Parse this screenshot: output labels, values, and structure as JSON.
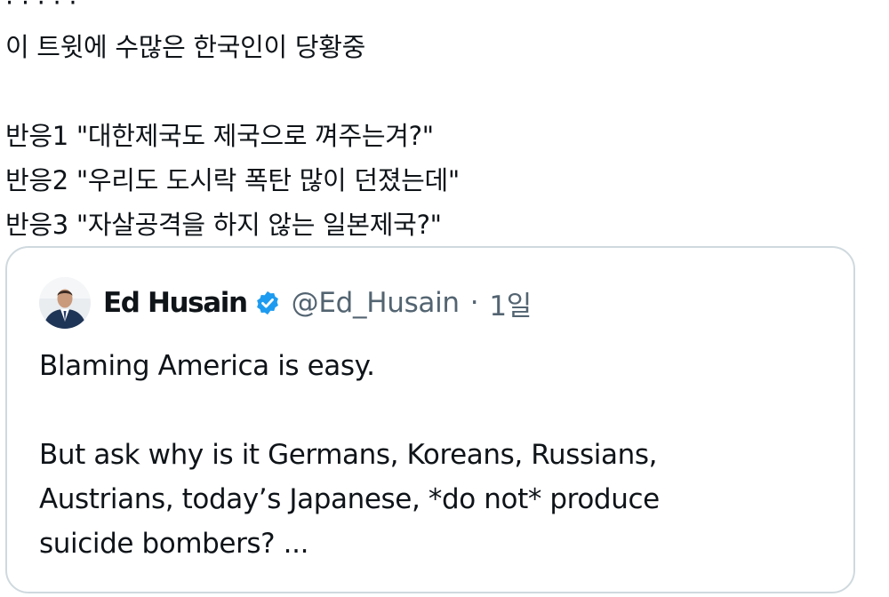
{
  "tweet": {
    "cut_line": "· · · · ·",
    "lines": [
      "이 트윗에 수많은 한국인이 당황중",
      "",
      "반응1 \"대한제국도 제국으로 껴주는겨?\"",
      "반응2 \"우리도 도시락 폭탄 많이 던졌는데\"",
      "반응3 \"자살공격을 하지 않는 일본제국?\""
    ]
  },
  "quote": {
    "author_name": "Ed Husain",
    "handle": "@Ed_Husain",
    "separator": "·",
    "time": "1일",
    "verified_color": "#1d9bf0",
    "text_lines": [
      "Blaming America is easy.",
      "",
      "But ask why is it Germans, Koreans, Russians,",
      "Austrians, today’s Japanese, *do not* produce",
      "suicide bombers? ..."
    ]
  }
}
